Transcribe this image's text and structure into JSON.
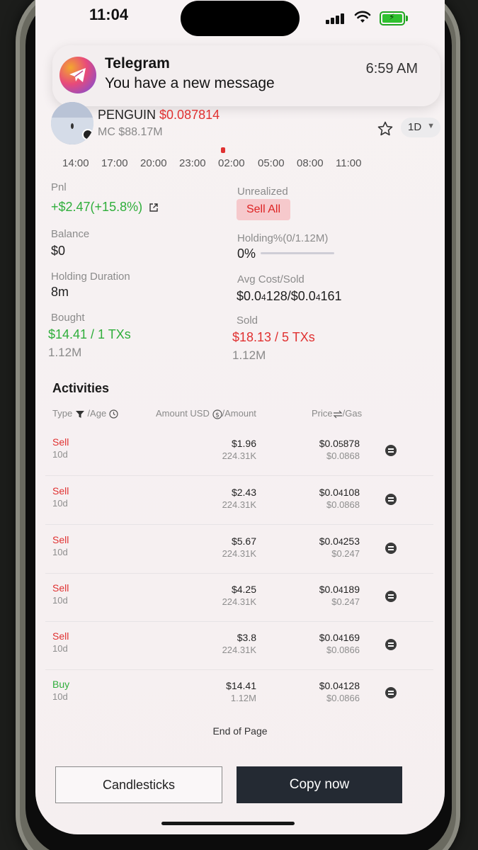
{
  "status_bar": {
    "time": "11:04"
  },
  "notification": {
    "app": "Telegram",
    "message": "You have a new message",
    "time": "6:59 AM"
  },
  "token": {
    "name": "PENGUIN",
    "price": "$0.087814",
    "mc": "MC $88.17M",
    "timeframe": "1D"
  },
  "chart_axis": {
    "labels": [
      "14:00",
      "17:00",
      "20:00",
      "23:00",
      "02:00",
      "05:00",
      "08:00",
      "11:00"
    ]
  },
  "stats": {
    "pnl_label": "Pnl",
    "pnl_value": "+$2.47(+15.8%)",
    "unrealized_label": "Unrealized",
    "sell_all": "Sell All",
    "balance_label": "Balance",
    "balance_value": "$0",
    "holding_label": "Holding%(0/1.12M)",
    "holding_value": "0%",
    "holding_fraction": 0,
    "duration_label": "Holding Duration",
    "duration_value": "8m",
    "avg_label": "Avg Cost/Sold",
    "avg_prefix_1": "$0.0",
    "avg_sub_1": "4",
    "avg_rest_1": "128/$0.0",
    "avg_sub_2": "4",
    "avg_rest_2": "161",
    "bought_label": "Bought",
    "bought_value": "$14.41 / 1 TXs",
    "bought_qty": "1.12M",
    "sold_label": "Sold",
    "sold_value": "$18.13 / 5 TXs",
    "sold_qty": "1.12M"
  },
  "activities": {
    "title": "Activities",
    "headers": {
      "type": "Type",
      "age": "/Age",
      "amount_usd": "Amount USD",
      "amount": "/Amount",
      "price": "Price",
      "gas": "/Gas"
    },
    "rows": [
      {
        "type": "Sell",
        "age": "10d",
        "usd": "$1.96",
        "qty": "224.31K",
        "p_pre": "$0.0",
        "p_sub": "5",
        "p_rest": "878",
        "gas": "$0.0868"
      },
      {
        "type": "Sell",
        "age": "10d",
        "usd": "$2.43",
        "qty": "224.31K",
        "p_pre": "$0.0",
        "p_sub": "4",
        "p_rest": "108",
        "gas": "$0.0868"
      },
      {
        "type": "Sell",
        "age": "10d",
        "usd": "$5.67",
        "qty": "224.31K",
        "p_pre": "$0.0",
        "p_sub": "4",
        "p_rest": "253",
        "gas": "$0.247"
      },
      {
        "type": "Sell",
        "age": "10d",
        "usd": "$4.25",
        "qty": "224.31K",
        "p_pre": "$0.0",
        "p_sub": "4",
        "p_rest": "189",
        "gas": "$0.247"
      },
      {
        "type": "Sell",
        "age": "10d",
        "usd": "$3.8",
        "qty": "224.31K",
        "p_pre": "$0.0",
        "p_sub": "4",
        "p_rest": "169",
        "gas": "$0.0866"
      },
      {
        "type": "Buy",
        "age": "10d",
        "usd": "$14.41",
        "qty": "1.12M",
        "p_pre": "$0.0",
        "p_sub": "4",
        "p_rest": "128",
        "gas": "$0.0866"
      }
    ],
    "end": "End of Page"
  },
  "buttons": {
    "candlesticks": "Candlesticks",
    "copy": "Copy now"
  },
  "colors": {
    "red": "#e03131",
    "green": "#2fae3b",
    "dark_button": "#242a33"
  }
}
